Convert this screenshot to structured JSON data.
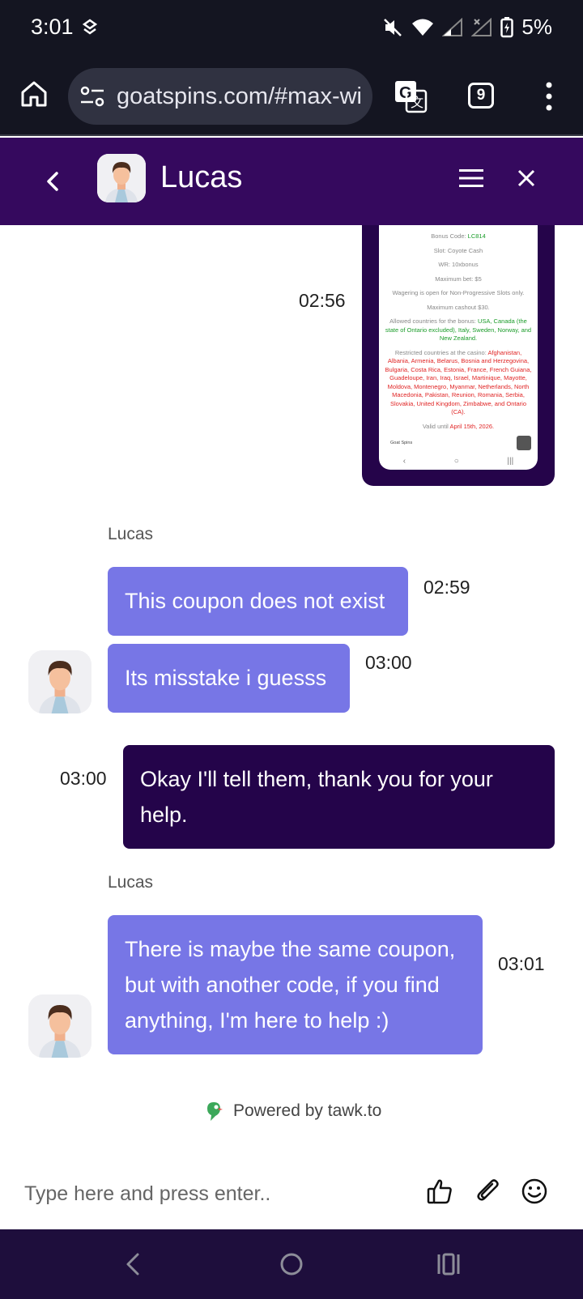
{
  "status_bar": {
    "time": "3:01",
    "battery": "5%"
  },
  "browser": {
    "url": "goatspins.com/#max-wi",
    "tab_count": "9"
  },
  "chat_header": {
    "agent_name": "Lucas"
  },
  "screenshot_card": {
    "time": "02:56",
    "lines": [
      {
        "prefix": "Bonus Code: ",
        "highlight": "LC814",
        "highlight_color": "green",
        "suffix": ""
      },
      {
        "prefix": "Slot: Coyote Cash",
        "highlight": "",
        "highlight_color": "",
        "suffix": ""
      },
      {
        "prefix": "WR: 10xbonus",
        "highlight": "",
        "highlight_color": "",
        "suffix": ""
      },
      {
        "prefix": "Maximum bet: $5",
        "highlight": "",
        "highlight_color": "",
        "suffix": ""
      },
      {
        "prefix": "Wagering is open for Non-Progressive Slots only.",
        "highlight": "",
        "highlight_color": "",
        "suffix": ""
      },
      {
        "prefix": "Maximum cashout $30.",
        "highlight": "",
        "highlight_color": "",
        "suffix": ""
      },
      {
        "prefix": "Allowed countries for the bonus: ",
        "highlight": "USA, Canada (the state of Ontario excluded), Italy, Sweden, Norway, and New Zealand.",
        "highlight_color": "green",
        "suffix": ""
      },
      {
        "prefix": "Restricted countries at the casino: ",
        "highlight": "Afghanistan, Albania, Armenia, Belarus, Bosnia and Herzegovina, Bulgaria, Costa Rica, Estonia, France, French Guiana, Guadeloupe, Iran, Iraq, Israel, Martinique, Mayotte, Moldova, Montenegro, Myanmar, Netherlands, North Macedonia, Pakistan, Reunion, Romania, Serbia, Slovakia, United Kingdom, Zimbabwe, and Ontario (CA).",
        "highlight_color": "red",
        "suffix": ""
      },
      {
        "prefix": "Valid until ",
        "highlight": "April 15th, 2026.",
        "highlight_color": "red",
        "suffix": ""
      }
    ],
    "footer_left": "Goat Spins"
  },
  "messages": [
    {
      "sender": "Lucas",
      "text": "This coupon does not exist",
      "time": "02:59"
    },
    {
      "sender": "",
      "text": "Its misstake i guesss",
      "time": "03:00"
    },
    {
      "sender": "visitor",
      "text": "Okay I'll tell them, thank you for your help.",
      "time": "03:00"
    },
    {
      "sender": "Lucas",
      "text": "There is maybe the same coupon, but with another code, if you find anything, I'm here to help :)",
      "time": "03:01"
    }
  ],
  "powered_by": "Powered by tawk.to",
  "input": {
    "placeholder": "Type here and press enter.."
  },
  "colors": {
    "header_bg": "#35095e",
    "agent_bubble": "#7776e6",
    "visitor_bubble": "#24044a",
    "nav_bg": "#1e0e3c"
  }
}
